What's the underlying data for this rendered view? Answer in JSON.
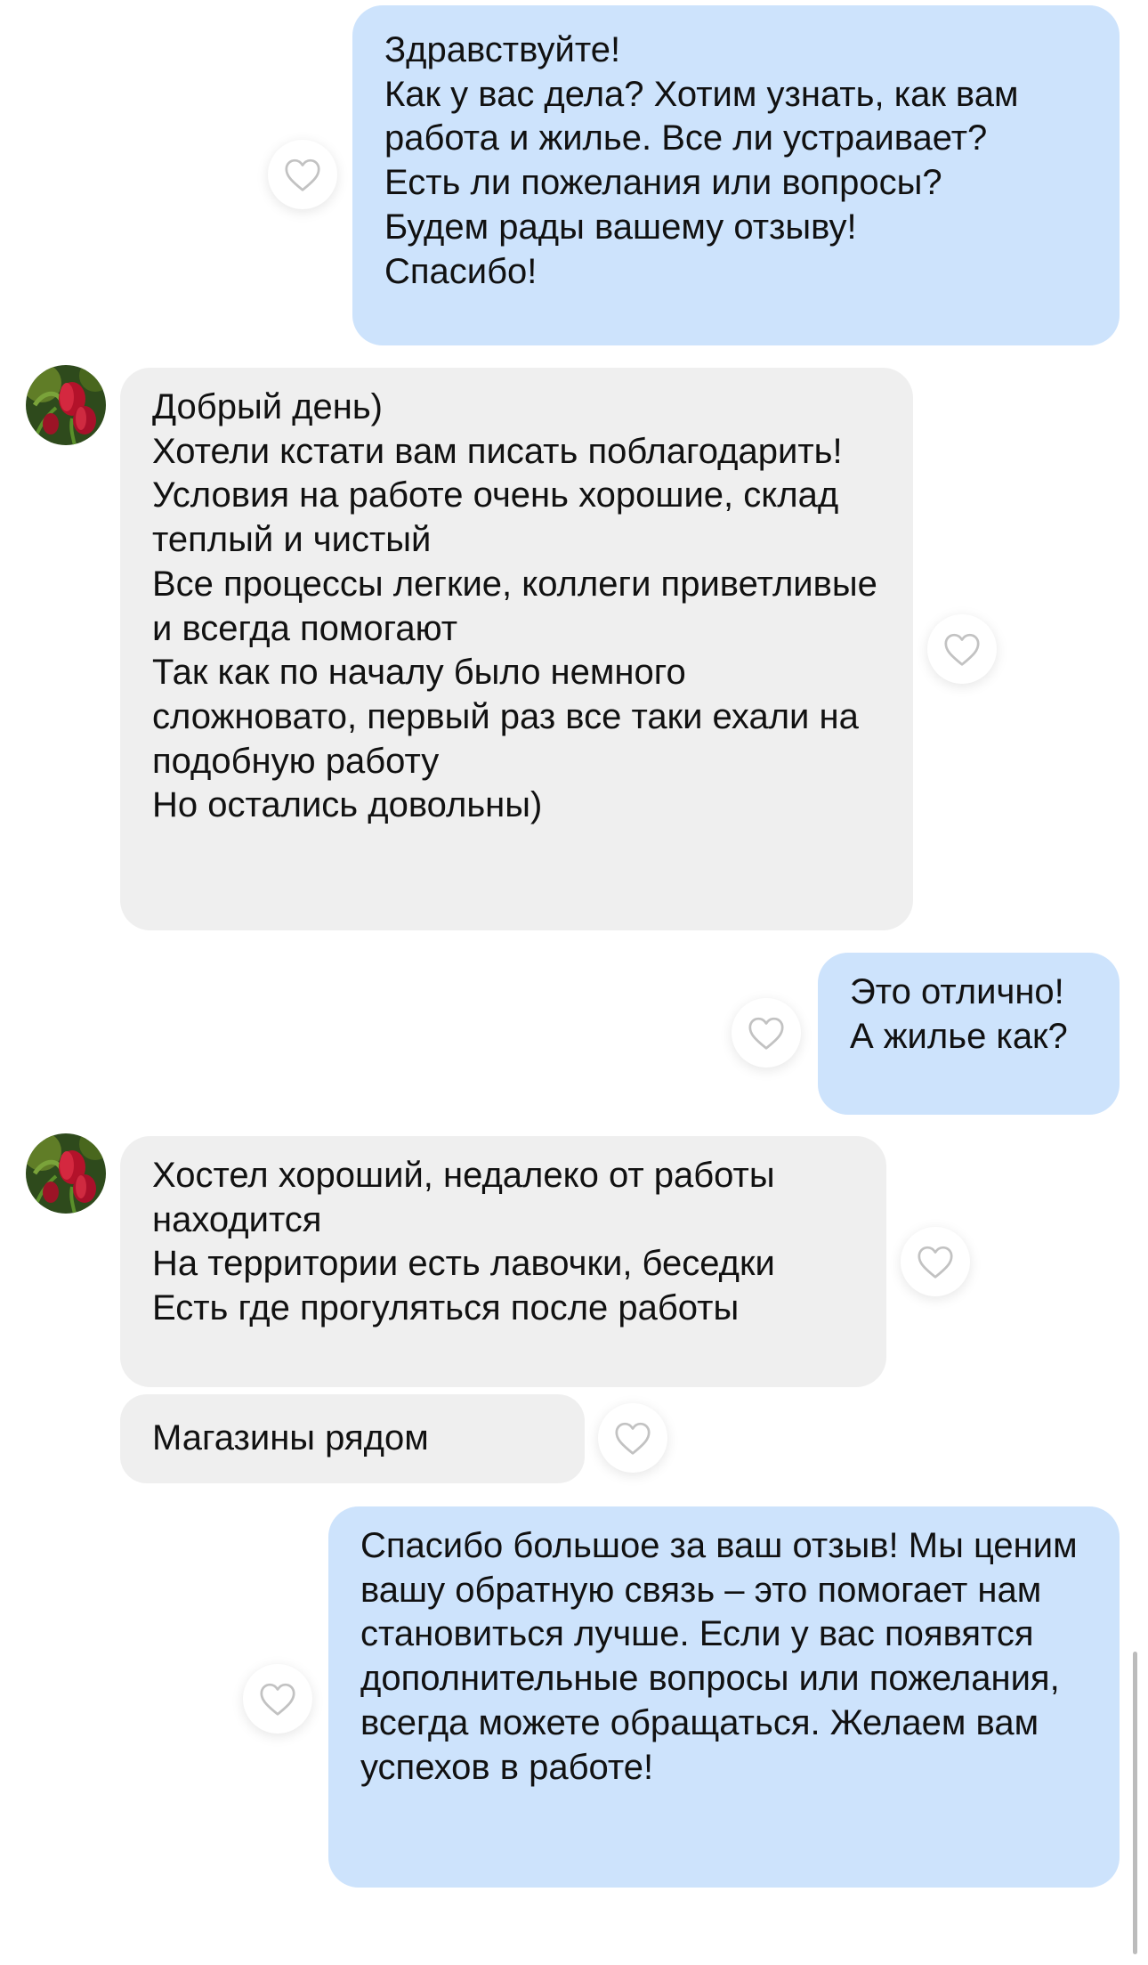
{
  "messages": [
    {
      "direction": "outgoing",
      "text": "Здравствуйте!\nКак у вас дела? Хотим узнать, как вам работа и жилье. Все ли устраивает?\nЕсть ли пожелания или вопросы?\nБудем рады вашему отзыву!\nСпасибо!",
      "reaction_icon": "heart-outline-icon"
    },
    {
      "direction": "incoming",
      "text": "Добрый день)\nХотели кстати вам писать поблагодарить!\nУсловия на работе очень хорошие, склад теплый и чистый\nВсе процессы легкие, коллеги приветливые и всегда помогают\nТак как по началу было немного сложновато, первый раз все таки ехали на подобную работу\nНо остались довольны)",
      "sender_avatar": "tulips-avatar",
      "reaction_icon": "heart-outline-icon"
    },
    {
      "direction": "outgoing",
      "text": "Это отлично!\nА жилье как?",
      "reaction_icon": "heart-outline-icon"
    },
    {
      "direction": "incoming",
      "text": "Хостел хороший, недалеко от работы находится\nНа территории есть лавочки, беседки\nЕсть где прогуляться после работы",
      "sender_avatar": "tulips-avatar",
      "reaction_icon": "heart-outline-icon"
    },
    {
      "direction": "incoming",
      "text": "Магазины рядом",
      "reaction_icon": "heart-outline-icon"
    },
    {
      "direction": "outgoing",
      "text": "Спасибо большое за ваш отзыв! Мы ценим вашу обратную связь – это помогает нам становиться лучше. Если у вас появятся дополнительные вопросы или пожелания, всегда можете обращаться. Желаем вам успехов в работе!",
      "reaction_icon": "heart-outline-icon"
    }
  ],
  "colors": {
    "outgoing_bubble": "#cde3fc",
    "incoming_bubble": "#efefef",
    "text": "#111111",
    "heart_stroke": "#c2c2c2"
  }
}
